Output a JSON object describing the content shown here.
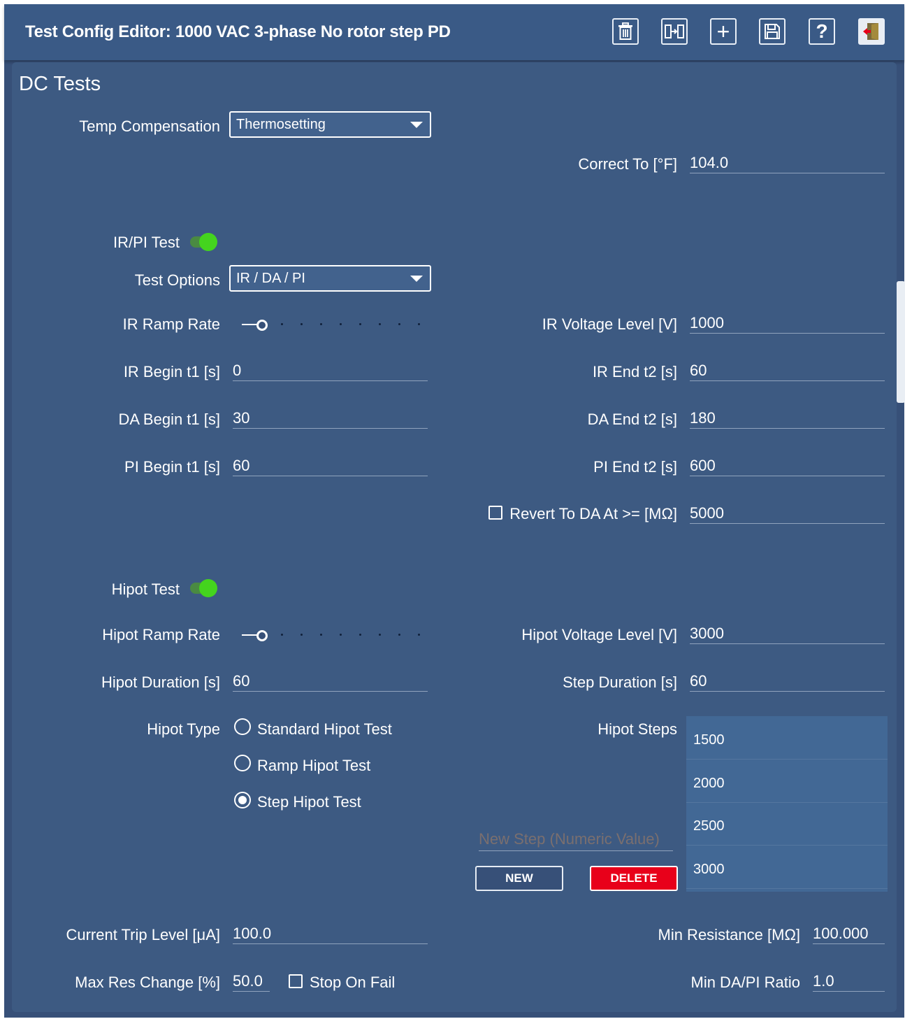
{
  "window": {
    "title": "Test Config Editor: 1000 VAC 3-phase No rotor step PD",
    "toolbar": {
      "delete_icon": "trash-icon",
      "move_icon": "move-icon",
      "add_label": "+",
      "save_icon": "save-icon",
      "help_label": "?",
      "exit_icon": "exit-icon"
    }
  },
  "section": {
    "title": "DC Tests"
  },
  "temp": {
    "label": "Temp Compensation",
    "value": "Thermosetting",
    "correct_to_label": "Correct To [°F]",
    "correct_to_value": "104.0"
  },
  "ir": {
    "test_label": "IR/PI Test",
    "test_enabled": true,
    "options_label": "Test Options",
    "options_value": "IR / DA / PI",
    "ramp_label": "IR Ramp Rate",
    "ramp_position": 1,
    "voltage_label": "IR Voltage Level [V]",
    "voltage_value": "1000",
    "begin_label": "IR Begin t1 [s]",
    "begin_value": "0",
    "end_label": "IR End t2 [s]",
    "end_value": "60"
  },
  "da": {
    "begin_label": "DA Begin t1 [s]",
    "begin_value": "30",
    "end_label": "DA End t2 [s]",
    "end_value": "180"
  },
  "pi": {
    "begin_label": "PI Begin t1 [s]",
    "begin_value": "60",
    "end_label": "PI End t2 [s]",
    "end_value": "600"
  },
  "revert": {
    "label": "Revert To DA At >= [MΩ]",
    "checked": false,
    "value": "5000"
  },
  "hipot": {
    "test_label": "Hipot Test",
    "test_enabled": true,
    "ramp_label": "Hipot Ramp Rate",
    "ramp_position": 1,
    "voltage_label": "Hipot Voltage Level [V]",
    "voltage_value": "3000",
    "duration_label": "Hipot Duration [s]",
    "duration_value": "60",
    "step_duration_label": "Step Duration [s]",
    "step_duration_value": "60",
    "type_label": "Hipot Type",
    "types": [
      "Standard Hipot Test",
      "Ramp Hipot Test",
      "Step Hipot Test"
    ],
    "selected_type": "Step Hipot Test",
    "steps_label": "Hipot Steps",
    "steps": [
      "1500",
      "2000",
      "2500",
      "3000"
    ],
    "new_step_placeholder": "New Step (Numeric Value)",
    "new_button": "NEW",
    "delete_button": "DELETE"
  },
  "limits": {
    "current_trip_label": "Current Trip Level [μA]",
    "current_trip_value": "100.0",
    "min_res_label": "Min Resistance [MΩ]",
    "min_res_value": "100.000",
    "max_res_change_label": "Max Res Change [%]",
    "max_res_change_value": "50.0",
    "stop_on_fail_label": "Stop On Fail",
    "stop_on_fail_checked": false,
    "min_ratio_label": "Min DA/PI Ratio",
    "min_ratio_value": "1.0"
  },
  "colors": {
    "background": "#375078",
    "panel": "#3d5a82",
    "toggle_on": "#44d41e",
    "delete_button": "#e8001a",
    "steps_list": "#426895"
  }
}
